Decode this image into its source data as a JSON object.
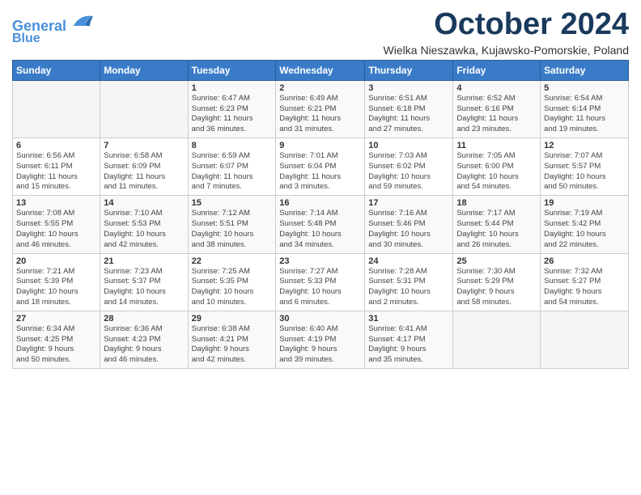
{
  "header": {
    "logo_line1": "General",
    "logo_line2": "Blue",
    "month_title": "October 2024",
    "subtitle": "Wielka Nieszawka, Kujawsko-Pomorskie, Poland"
  },
  "weekdays": [
    "Sunday",
    "Monday",
    "Tuesday",
    "Wednesday",
    "Thursday",
    "Friday",
    "Saturday"
  ],
  "weeks": [
    [
      {
        "day": "",
        "info": ""
      },
      {
        "day": "",
        "info": ""
      },
      {
        "day": "1",
        "info": "Sunrise: 6:47 AM\nSunset: 6:23 PM\nDaylight: 11 hours\nand 36 minutes."
      },
      {
        "day": "2",
        "info": "Sunrise: 6:49 AM\nSunset: 6:21 PM\nDaylight: 11 hours\nand 31 minutes."
      },
      {
        "day": "3",
        "info": "Sunrise: 6:51 AM\nSunset: 6:18 PM\nDaylight: 11 hours\nand 27 minutes."
      },
      {
        "day": "4",
        "info": "Sunrise: 6:52 AM\nSunset: 6:16 PM\nDaylight: 11 hours\nand 23 minutes."
      },
      {
        "day": "5",
        "info": "Sunrise: 6:54 AM\nSunset: 6:14 PM\nDaylight: 11 hours\nand 19 minutes."
      }
    ],
    [
      {
        "day": "6",
        "info": "Sunrise: 6:56 AM\nSunset: 6:11 PM\nDaylight: 11 hours\nand 15 minutes."
      },
      {
        "day": "7",
        "info": "Sunrise: 6:58 AM\nSunset: 6:09 PM\nDaylight: 11 hours\nand 11 minutes."
      },
      {
        "day": "8",
        "info": "Sunrise: 6:59 AM\nSunset: 6:07 PM\nDaylight: 11 hours\nand 7 minutes."
      },
      {
        "day": "9",
        "info": "Sunrise: 7:01 AM\nSunset: 6:04 PM\nDaylight: 11 hours\nand 3 minutes."
      },
      {
        "day": "10",
        "info": "Sunrise: 7:03 AM\nSunset: 6:02 PM\nDaylight: 10 hours\nand 59 minutes."
      },
      {
        "day": "11",
        "info": "Sunrise: 7:05 AM\nSunset: 6:00 PM\nDaylight: 10 hours\nand 54 minutes."
      },
      {
        "day": "12",
        "info": "Sunrise: 7:07 AM\nSunset: 5:57 PM\nDaylight: 10 hours\nand 50 minutes."
      }
    ],
    [
      {
        "day": "13",
        "info": "Sunrise: 7:08 AM\nSunset: 5:55 PM\nDaylight: 10 hours\nand 46 minutes."
      },
      {
        "day": "14",
        "info": "Sunrise: 7:10 AM\nSunset: 5:53 PM\nDaylight: 10 hours\nand 42 minutes."
      },
      {
        "day": "15",
        "info": "Sunrise: 7:12 AM\nSunset: 5:51 PM\nDaylight: 10 hours\nand 38 minutes."
      },
      {
        "day": "16",
        "info": "Sunrise: 7:14 AM\nSunset: 5:48 PM\nDaylight: 10 hours\nand 34 minutes."
      },
      {
        "day": "17",
        "info": "Sunrise: 7:16 AM\nSunset: 5:46 PM\nDaylight: 10 hours\nand 30 minutes."
      },
      {
        "day": "18",
        "info": "Sunrise: 7:17 AM\nSunset: 5:44 PM\nDaylight: 10 hours\nand 26 minutes."
      },
      {
        "day": "19",
        "info": "Sunrise: 7:19 AM\nSunset: 5:42 PM\nDaylight: 10 hours\nand 22 minutes."
      }
    ],
    [
      {
        "day": "20",
        "info": "Sunrise: 7:21 AM\nSunset: 5:39 PM\nDaylight: 10 hours\nand 18 minutes."
      },
      {
        "day": "21",
        "info": "Sunrise: 7:23 AM\nSunset: 5:37 PM\nDaylight: 10 hours\nand 14 minutes."
      },
      {
        "day": "22",
        "info": "Sunrise: 7:25 AM\nSunset: 5:35 PM\nDaylight: 10 hours\nand 10 minutes."
      },
      {
        "day": "23",
        "info": "Sunrise: 7:27 AM\nSunset: 5:33 PM\nDaylight: 10 hours\nand 6 minutes."
      },
      {
        "day": "24",
        "info": "Sunrise: 7:28 AM\nSunset: 5:31 PM\nDaylight: 10 hours\nand 2 minutes."
      },
      {
        "day": "25",
        "info": "Sunrise: 7:30 AM\nSunset: 5:29 PM\nDaylight: 9 hours\nand 58 minutes."
      },
      {
        "day": "26",
        "info": "Sunrise: 7:32 AM\nSunset: 5:27 PM\nDaylight: 9 hours\nand 54 minutes."
      }
    ],
    [
      {
        "day": "27",
        "info": "Sunrise: 6:34 AM\nSunset: 4:25 PM\nDaylight: 9 hours\nand 50 minutes."
      },
      {
        "day": "28",
        "info": "Sunrise: 6:36 AM\nSunset: 4:23 PM\nDaylight: 9 hours\nand 46 minutes."
      },
      {
        "day": "29",
        "info": "Sunrise: 6:38 AM\nSunset: 4:21 PM\nDaylight: 9 hours\nand 42 minutes."
      },
      {
        "day": "30",
        "info": "Sunrise: 6:40 AM\nSunset: 4:19 PM\nDaylight: 9 hours\nand 39 minutes."
      },
      {
        "day": "31",
        "info": "Sunrise: 6:41 AM\nSunset: 4:17 PM\nDaylight: 9 hours\nand 35 minutes."
      },
      {
        "day": "",
        "info": ""
      },
      {
        "day": "",
        "info": ""
      }
    ]
  ]
}
